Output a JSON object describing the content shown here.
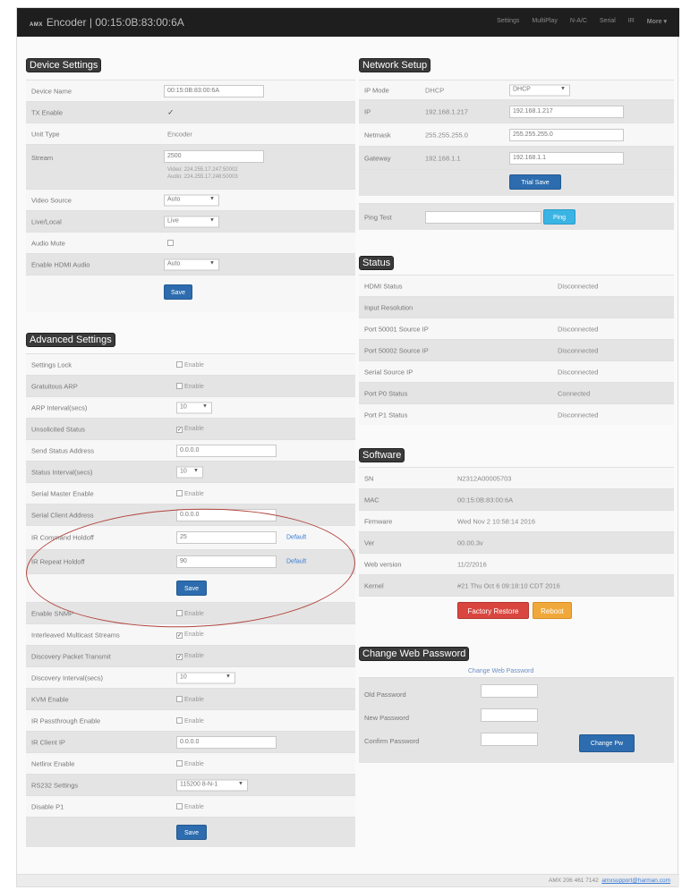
{
  "navbar": {
    "logo": "AMX",
    "title": "Encoder | 00:15:0B:83:00:6A",
    "links": [
      "Settings",
      "MultiPlay",
      "N-A/C",
      "Serial",
      "IR"
    ],
    "more": "More"
  },
  "device": {
    "title": "Device Settings",
    "device_name_label": "Device Name",
    "device_name_value": "00:15:0B:83:00:6A",
    "tx_enable_label": "TX Enable",
    "tx_enable_check": "✓",
    "unit_type_label": "Unit Type",
    "unit_type_value": "Encoder",
    "stream_label": "Stream",
    "stream_value": "2500",
    "stream_video": "Video: 224.255.17.247:50002",
    "stream_audio": "Audio: 224.255.17.248:50003",
    "video_source_label": "Video Source",
    "video_source_value": "Auto",
    "live_local_label": "Live/Local",
    "live_local_value": "Live",
    "audio_mute_label": "Audio Mute",
    "enable_hdmi_audio_label": "Enable HDMI Audio",
    "enable_hdmi_audio_value": "Auto",
    "save": "Save"
  },
  "advanced": {
    "title": "Advanced Settings",
    "settings_lock_label": "Settings Lock",
    "settings_lock_check": "Enable",
    "gratuitous_arp_label": "Gratuitous ARP",
    "gratuitous_arp_check": "Enable",
    "arp_interval_label": "ARP Interval(secs)",
    "arp_interval_value": "10",
    "unsolicited_status_label": "Unsolicited Status",
    "unsolicited_status_check": "Enable",
    "send_status_label": "Send Status Address",
    "send_status_value": "0.0.0.0",
    "status_interval_label": "Status Interval(secs)",
    "status_interval_value": "10",
    "serial_master_label": "Serial Master Enable",
    "serial_master_check": "Enable",
    "serial_client_label": "Serial Client Address",
    "serial_client_value": "0.0.0.0",
    "ir_command_label": "IR Command Holdoff",
    "ir_command_value": "25",
    "ir_command_default": "Default",
    "ir_repeat_label": "IR Repeat Holdoff",
    "ir_repeat_value": "90",
    "ir_repeat_default": "Default",
    "save": "Save",
    "enable_snmp_label": "Enable SNMP",
    "enable_snmp_check": "Enable",
    "interleaved_label": "Interleaved Multicast Streams",
    "interleaved_check": "Enable",
    "discovery_transmit_label": "Discovery Packet Transmit",
    "discovery_transmit_check": "Enable",
    "discovery_interval_label": "Discovery Interval(secs)",
    "discovery_interval_value": "10",
    "kvm_enable_label": "KVM Enable",
    "kvm_enable_check": "Enable",
    "ir_passthrough_label": "IR Passthrough Enable",
    "ir_passthrough_check": "Enable",
    "ir_client_label": "IR Client IP",
    "ir_client_value": "0.0.0.0",
    "netlinx_label": "Netlinx Enable",
    "netlinx_check": "Enable",
    "rs232_label": "RS232 Settings",
    "rs232_value": "115200 8-N-1",
    "disable_p1_label": "Disable P1",
    "disable_p1_check": "Enable",
    "save2": "Save"
  },
  "network": {
    "title": "Network Setup",
    "ip_mode_label": "IP Mode",
    "ip_mode_value": "DHCP",
    "ip_mode_select": "DHCP",
    "ip_label": "IP",
    "ip_value": "192.168.1.217",
    "ip_input": "192.168.1.217",
    "netmask_label": "Netmask",
    "netmask_value": "255.255.255.0",
    "netmask_input": "255.255.255.0",
    "gateway_label": "Gateway",
    "gateway_value": "192.168.1.1",
    "gateway_input": "192.168.1.1",
    "trial_save": "Trial Save",
    "ping_label": "Ping Test",
    "ping_button": "Ping"
  },
  "status": {
    "title": "Status",
    "rows": [
      {
        "label": "HDMI Status",
        "value": "Disconnected"
      },
      {
        "label": "Input Resolution",
        "value": ""
      },
      {
        "label": "Port 50001 Source IP",
        "value": "Disconnected"
      },
      {
        "label": "Port 50002 Source IP",
        "value": "Disconnected"
      },
      {
        "label": "Serial Source IP",
        "value": "Disconnected"
      },
      {
        "label": "Port P0 Status",
        "value": "Connected"
      },
      {
        "label": "Port P1 Status",
        "value": "Disconnected"
      }
    ]
  },
  "software": {
    "title": "Software",
    "rows": [
      {
        "label": "SN",
        "value": "N2312A00005703"
      },
      {
        "label": "MAC",
        "value": "00:15:0B:83:00:6A"
      },
      {
        "label": "Firmware",
        "value": "Wed Nov 2 10:58:14 2016"
      },
      {
        "label": "Ver",
        "value": "00.00.3v"
      },
      {
        "label": "Web version",
        "value": "11/2/2016"
      },
      {
        "label": "Kernel",
        "value": "#21 Thu Oct 6 09:18:10 CDT 2016"
      }
    ],
    "factory_restore": "Factory Restore",
    "reboot": "Reboot"
  },
  "password": {
    "title": "Change Web Password",
    "subtitle": "Change Web Password",
    "old_label": "Old Password",
    "new_label": "New Password",
    "confirm_label": "Confirm Password",
    "button": "Change Pw"
  },
  "footer": {
    "text": "AMX   206 461 7142",
    "link": "amxsupport@harman.com"
  }
}
